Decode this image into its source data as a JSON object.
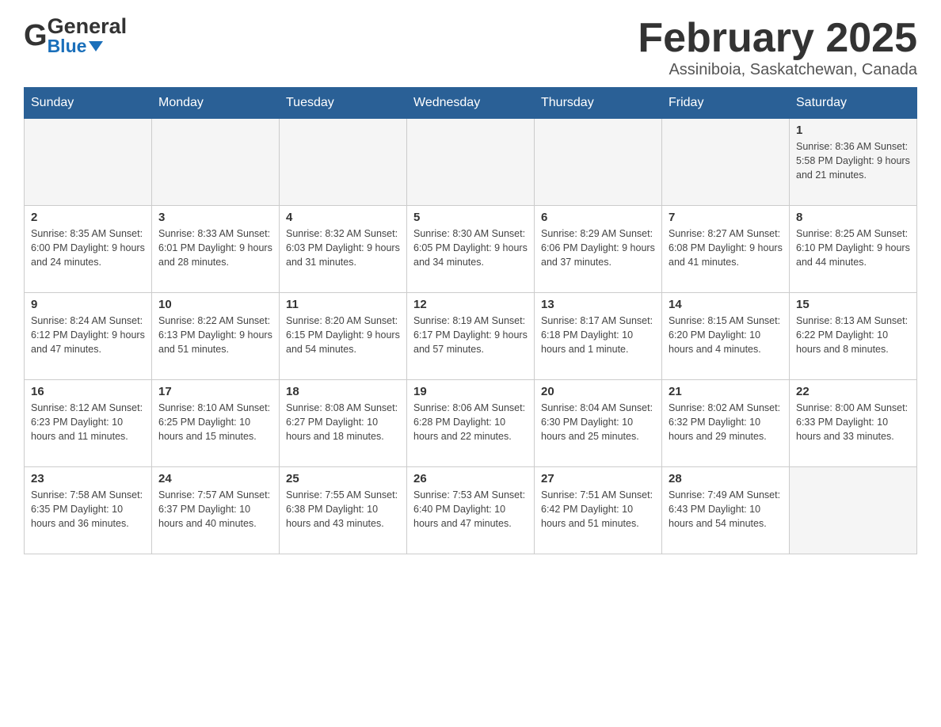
{
  "logo": {
    "general": "General",
    "blue": "Blue"
  },
  "title": "February 2025",
  "subtitle": "Assiniboia, Saskatchewan, Canada",
  "days_header": [
    "Sunday",
    "Monday",
    "Tuesday",
    "Wednesday",
    "Thursday",
    "Friday",
    "Saturday"
  ],
  "weeks": [
    [
      {
        "day": "",
        "info": ""
      },
      {
        "day": "",
        "info": ""
      },
      {
        "day": "",
        "info": ""
      },
      {
        "day": "",
        "info": ""
      },
      {
        "day": "",
        "info": ""
      },
      {
        "day": "",
        "info": ""
      },
      {
        "day": "1",
        "info": "Sunrise: 8:36 AM\nSunset: 5:58 PM\nDaylight: 9 hours and 21 minutes."
      }
    ],
    [
      {
        "day": "2",
        "info": "Sunrise: 8:35 AM\nSunset: 6:00 PM\nDaylight: 9 hours and 24 minutes."
      },
      {
        "day": "3",
        "info": "Sunrise: 8:33 AM\nSunset: 6:01 PM\nDaylight: 9 hours and 28 minutes."
      },
      {
        "day": "4",
        "info": "Sunrise: 8:32 AM\nSunset: 6:03 PM\nDaylight: 9 hours and 31 minutes."
      },
      {
        "day": "5",
        "info": "Sunrise: 8:30 AM\nSunset: 6:05 PM\nDaylight: 9 hours and 34 minutes."
      },
      {
        "day": "6",
        "info": "Sunrise: 8:29 AM\nSunset: 6:06 PM\nDaylight: 9 hours and 37 minutes."
      },
      {
        "day": "7",
        "info": "Sunrise: 8:27 AM\nSunset: 6:08 PM\nDaylight: 9 hours and 41 minutes."
      },
      {
        "day": "8",
        "info": "Sunrise: 8:25 AM\nSunset: 6:10 PM\nDaylight: 9 hours and 44 minutes."
      }
    ],
    [
      {
        "day": "9",
        "info": "Sunrise: 8:24 AM\nSunset: 6:12 PM\nDaylight: 9 hours and 47 minutes."
      },
      {
        "day": "10",
        "info": "Sunrise: 8:22 AM\nSunset: 6:13 PM\nDaylight: 9 hours and 51 minutes."
      },
      {
        "day": "11",
        "info": "Sunrise: 8:20 AM\nSunset: 6:15 PM\nDaylight: 9 hours and 54 minutes."
      },
      {
        "day": "12",
        "info": "Sunrise: 8:19 AM\nSunset: 6:17 PM\nDaylight: 9 hours and 57 minutes."
      },
      {
        "day": "13",
        "info": "Sunrise: 8:17 AM\nSunset: 6:18 PM\nDaylight: 10 hours and 1 minute."
      },
      {
        "day": "14",
        "info": "Sunrise: 8:15 AM\nSunset: 6:20 PM\nDaylight: 10 hours and 4 minutes."
      },
      {
        "day": "15",
        "info": "Sunrise: 8:13 AM\nSunset: 6:22 PM\nDaylight: 10 hours and 8 minutes."
      }
    ],
    [
      {
        "day": "16",
        "info": "Sunrise: 8:12 AM\nSunset: 6:23 PM\nDaylight: 10 hours and 11 minutes."
      },
      {
        "day": "17",
        "info": "Sunrise: 8:10 AM\nSunset: 6:25 PM\nDaylight: 10 hours and 15 minutes."
      },
      {
        "day": "18",
        "info": "Sunrise: 8:08 AM\nSunset: 6:27 PM\nDaylight: 10 hours and 18 minutes."
      },
      {
        "day": "19",
        "info": "Sunrise: 8:06 AM\nSunset: 6:28 PM\nDaylight: 10 hours and 22 minutes."
      },
      {
        "day": "20",
        "info": "Sunrise: 8:04 AM\nSunset: 6:30 PM\nDaylight: 10 hours and 25 minutes."
      },
      {
        "day": "21",
        "info": "Sunrise: 8:02 AM\nSunset: 6:32 PM\nDaylight: 10 hours and 29 minutes."
      },
      {
        "day": "22",
        "info": "Sunrise: 8:00 AM\nSunset: 6:33 PM\nDaylight: 10 hours and 33 minutes."
      }
    ],
    [
      {
        "day": "23",
        "info": "Sunrise: 7:58 AM\nSunset: 6:35 PM\nDaylight: 10 hours and 36 minutes."
      },
      {
        "day": "24",
        "info": "Sunrise: 7:57 AM\nSunset: 6:37 PM\nDaylight: 10 hours and 40 minutes."
      },
      {
        "day": "25",
        "info": "Sunrise: 7:55 AM\nSunset: 6:38 PM\nDaylight: 10 hours and 43 minutes."
      },
      {
        "day": "26",
        "info": "Sunrise: 7:53 AM\nSunset: 6:40 PM\nDaylight: 10 hours and 47 minutes."
      },
      {
        "day": "27",
        "info": "Sunrise: 7:51 AM\nSunset: 6:42 PM\nDaylight: 10 hours and 51 minutes."
      },
      {
        "day": "28",
        "info": "Sunrise: 7:49 AM\nSunset: 6:43 PM\nDaylight: 10 hours and 54 minutes."
      },
      {
        "day": "",
        "info": ""
      }
    ]
  ]
}
